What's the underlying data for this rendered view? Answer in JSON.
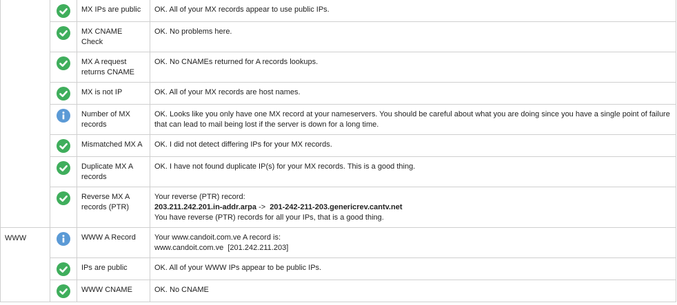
{
  "colors": {
    "ok": "#3fae5c",
    "info": "#5b9ad6",
    "border": "#cfcfcf"
  },
  "rows": [
    {
      "category": "",
      "status": "ok",
      "icon": "check-icon",
      "test": "MX IPs are public",
      "info": "OK. All of your MX records appear to use public IPs."
    },
    {
      "category": "",
      "status": "ok",
      "icon": "check-icon",
      "test": "MX CNAME Check",
      "info": "OK. No problems here."
    },
    {
      "category": "",
      "status": "ok",
      "icon": "check-icon",
      "test": "MX A request returns CNAME",
      "info": "OK. No CNAMEs returned for A records lookups."
    },
    {
      "category": "",
      "status": "ok",
      "icon": "check-icon",
      "test": "MX is not IP",
      "info": "OK. All of your MX records are host names."
    },
    {
      "category": "",
      "status": "info",
      "icon": "info-icon",
      "test": "Number of MX records",
      "info": "OK. Looks like you only have one MX record at your nameservers. You should be careful about what you are doing since you have a single point of failure that can lead to mail being lost if the server is down for a long time."
    },
    {
      "category": "",
      "status": "ok",
      "icon": "check-icon",
      "test": "Mismatched MX A",
      "info": "OK. I did not detect differing IPs for your MX records."
    },
    {
      "category": "",
      "status": "ok",
      "icon": "check-icon",
      "test": "Duplicate MX A records",
      "info": "OK. I have not found duplicate IP(s) for your MX records. This is a good thing."
    },
    {
      "category": "",
      "status": "ok",
      "icon": "check-icon",
      "test": "Reverse MX A records (PTR)",
      "info_lines": [
        "Your reverse (PTR) record:"
      ],
      "ptr_record": "203.211.242.201.in-addr.arpa",
      "ptr_arrow": "->",
      "ptr_target": "201-242-211-203.genericrev.cantv.net",
      "info_footer": "You have reverse (PTR) records for all your IPs, that is a good thing."
    },
    {
      "category": "WWW",
      "status": "info",
      "icon": "info-icon",
      "test": "WWW A Record",
      "info_lines": [
        "Your www.candoit.com.ve A record is:",
        "www.candoit.com.ve  [201.242.211.203]"
      ]
    },
    {
      "category": "",
      "status": "ok",
      "icon": "check-icon",
      "test": "IPs are public",
      "info": "OK. All of your WWW IPs appear to be public IPs."
    },
    {
      "category": "",
      "status": "ok",
      "icon": "check-icon",
      "test": "WWW CNAME",
      "info": "OK. No CNAME"
    }
  ]
}
